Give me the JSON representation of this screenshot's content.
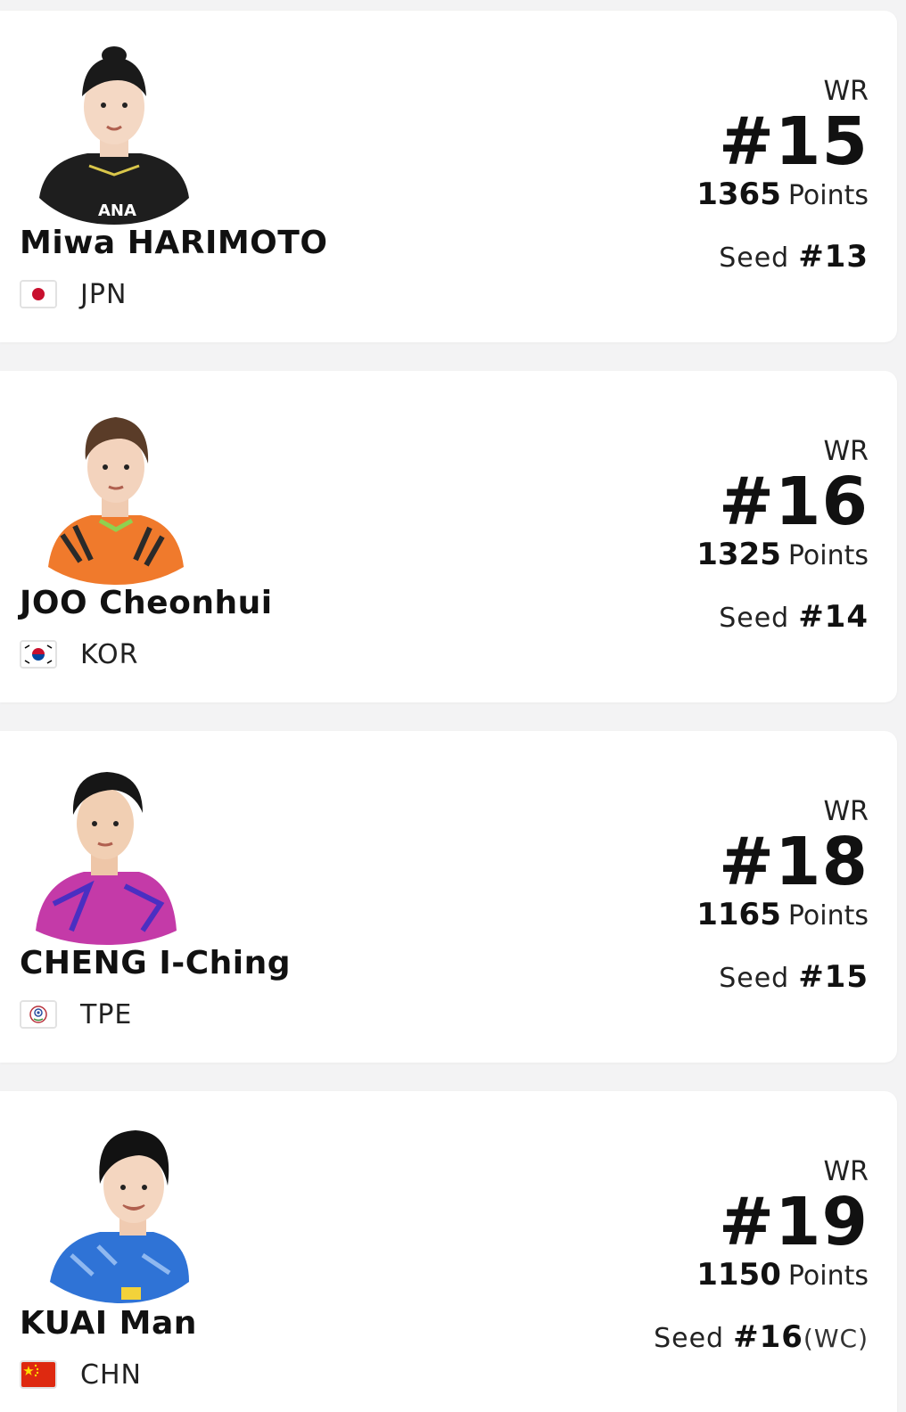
{
  "players": [
    {
      "name": "Miwa HARIMOTO",
      "country": "JPN",
      "flag_icon": "japan-flag-icon",
      "wr_label": "WR",
      "rank": "#15",
      "points_value": "1365",
      "points_label": "Points",
      "seed_label": "Seed",
      "seed_value": "#13",
      "seed_extra": "",
      "jersey_color": "#1e1e1e"
    },
    {
      "name": "JOO Cheonhui",
      "country": "KOR",
      "flag_icon": "korea-flag-icon",
      "wr_label": "WR",
      "rank": "#16",
      "points_value": "1325",
      "points_label": "Points",
      "seed_label": "Seed",
      "seed_value": "#14",
      "seed_extra": "",
      "jersey_color": "#f07a2c"
    },
    {
      "name": "CHENG I-Ching",
      "country": "TPE",
      "flag_icon": "chinese-taipei-flag-icon",
      "wr_label": "WR",
      "rank": "#18",
      "points_value": "1165",
      "points_label": "Points",
      "seed_label": "Seed",
      "seed_value": "#15",
      "seed_extra": "",
      "jersey_color": "#c43aa8"
    },
    {
      "name": "KUAI Man",
      "country": "CHN",
      "flag_icon": "china-flag-icon",
      "wr_label": "WR",
      "rank": "#19",
      "points_value": "1150",
      "points_label": "Points",
      "seed_label": "Seed",
      "seed_value": "#16",
      "seed_extra": "(WC)",
      "jersey_color": "#2f73d6"
    }
  ]
}
